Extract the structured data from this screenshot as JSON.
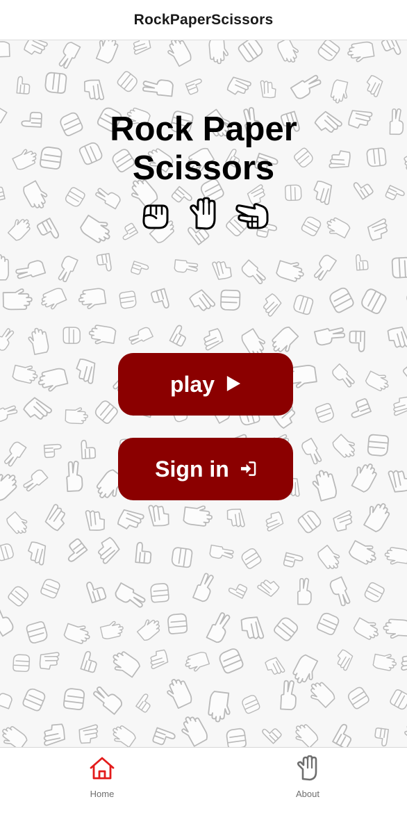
{
  "header": {
    "title": "RockPaperScissors"
  },
  "hero": {
    "title_line1": "Rock Paper",
    "title_line2": "Scissors",
    "hand_icons": [
      "fist-icon",
      "raised-hand-icon",
      "scissors-hand-icon"
    ]
  },
  "buttons": {
    "play_label": "play",
    "play_icon": "play-icon",
    "signin_label": "Sign in",
    "signin_icon": "sign-in-icon"
  },
  "tabs": [
    {
      "label": "Home",
      "icon": "home-icon",
      "active": true
    },
    {
      "label": "About",
      "icon": "hand-icon",
      "active": false
    }
  ],
  "colors": {
    "button": "#8b0000",
    "tab_active": "#e31b1b",
    "tab_inactive": "#6e6e6e",
    "pattern": "#b9b9b9"
  }
}
